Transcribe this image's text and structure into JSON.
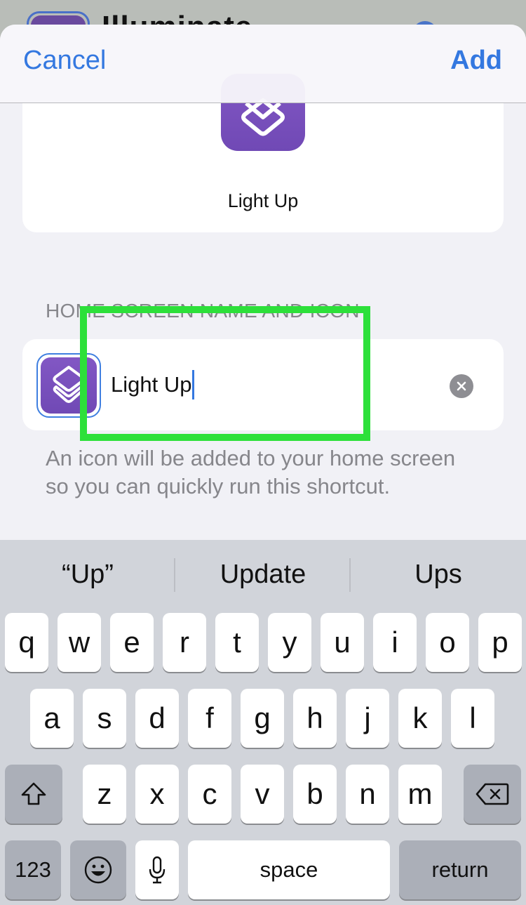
{
  "background_app": {
    "title": "Illuminate"
  },
  "navbar": {
    "cancel_label": "Cancel",
    "add_label": "Add"
  },
  "preview": {
    "icon": "shortcuts-layers-icon",
    "label": "Light Up"
  },
  "home_screen": {
    "section_header": "HOME SCREEN NAME AND ICON",
    "icon": "shortcuts-layers-icon",
    "name_value": "Light Up",
    "clear_icon": "clear-circle-icon",
    "footer": "An icon will be added to your home screen so you can quickly run this shortcut."
  },
  "keyboard": {
    "suggestions": [
      "“Up”",
      "Update",
      "Ups"
    ],
    "row1": [
      "q",
      "w",
      "e",
      "r",
      "t",
      "y",
      "u",
      "i",
      "o",
      "p"
    ],
    "row2": [
      "a",
      "s",
      "d",
      "f",
      "g",
      "h",
      "j",
      "k",
      "l"
    ],
    "row3": [
      "z",
      "x",
      "c",
      "v",
      "b",
      "n",
      "m"
    ],
    "shift_icon": "shift-icon",
    "backspace_icon": "backspace-icon",
    "numbers_label": "123",
    "emoji_icon": "emoji-icon",
    "mic_icon": "microphone-icon",
    "space_label": "space",
    "return_label": "return"
  },
  "colors": {
    "accent": "#3478e0",
    "icon_purple": "#7a50be",
    "highlight": "#2de03a"
  }
}
